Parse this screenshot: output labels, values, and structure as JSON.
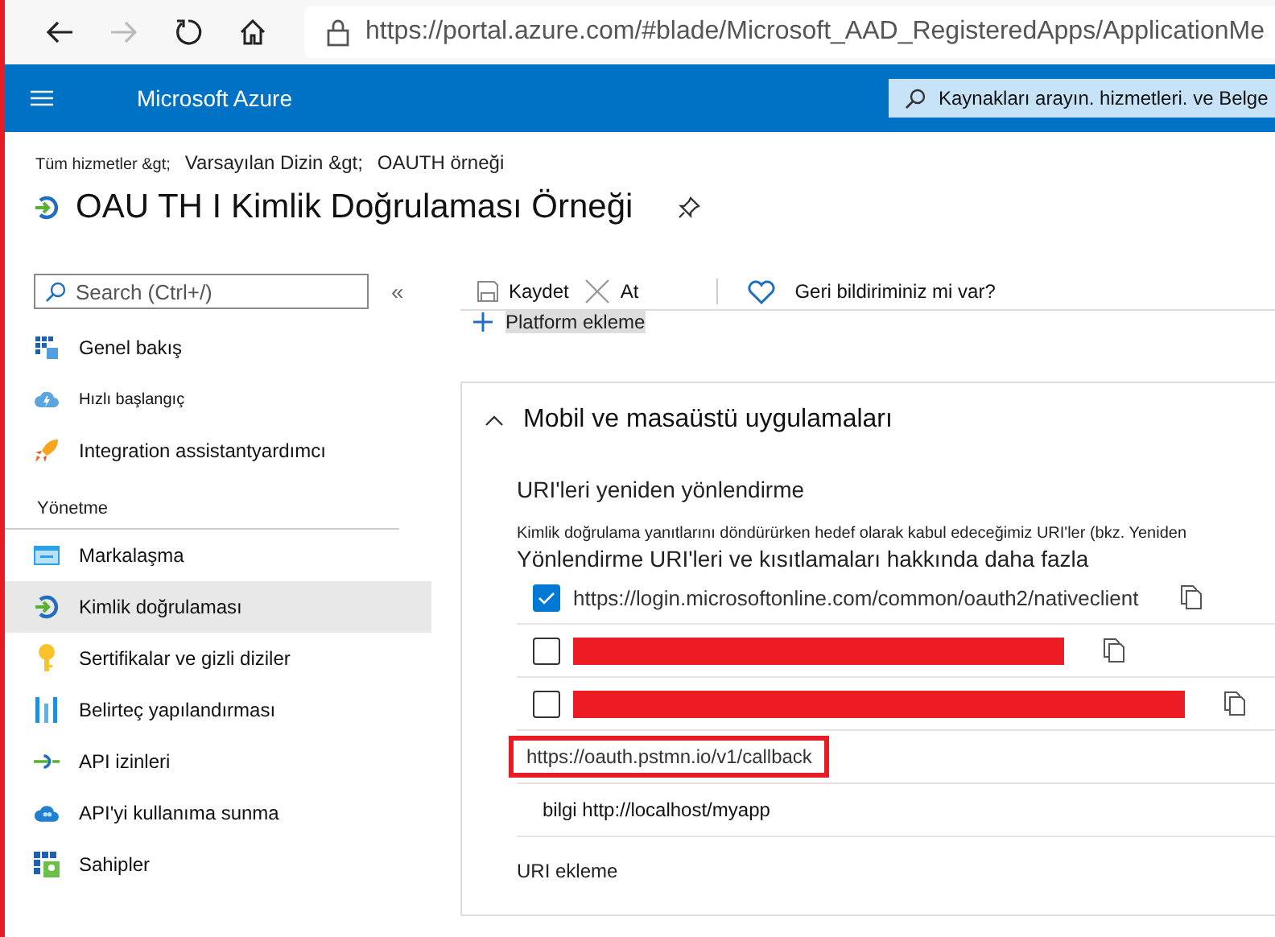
{
  "browser": {
    "url": "https://portal.azure.com/#blade/Microsoft_AAD_RegisteredApps/ApplicationMe"
  },
  "header": {
    "brand": "Microsoft Azure",
    "search_placeholder": "Kaynakları arayın. hizmetleri. ve Belge"
  },
  "breadcrumb": [
    "Tüm hizmetler &gt;",
    "Varsayılan Dizin &gt;",
    "OAUTH örneği"
  ],
  "title": "OAU TH I Kimlik Doğrulaması Örneği",
  "sidebar": {
    "search_placeholder": "Search (Ctrl+/)",
    "collapse": "«",
    "items": [
      {
        "kind": "item",
        "label": "Genel bakış",
        "selected": false
      },
      {
        "kind": "item",
        "label": "Hızlı başlangıç",
        "selected": false
      },
      {
        "kind": "item",
        "label": "Integration assistantyardımcı",
        "selected": false
      },
      {
        "kind": "section",
        "label": "Yönetme"
      },
      {
        "kind": "item",
        "label": "Markalaşma",
        "selected": false
      },
      {
        "kind": "item",
        "label": "Kimlik doğrulaması",
        "selected": true
      },
      {
        "kind": "item",
        "label": "Sertifikalar ve gizli diziler",
        "selected": false
      },
      {
        "kind": "item",
        "label": "Belirteç yapılandırması",
        "selected": false
      },
      {
        "kind": "item",
        "label": "API izinleri",
        "selected": false
      },
      {
        "kind": "item",
        "label": "API'yi kullanıma sunma",
        "selected": false
      },
      {
        "kind": "item",
        "label": "Sahipler",
        "selected": false
      }
    ]
  },
  "toolbar": {
    "save": "Kaydet",
    "discard": "At",
    "feedback": "Geri bildiriminiz mi var?"
  },
  "add_platform": "Platform ekleme",
  "panel": {
    "title": "Mobil ve masaüstü uygulamaları",
    "expanded": true,
    "section_title": "URI'leri yeniden yönlendirme",
    "description": "Kimlik doğrulama yanıtlarını döndürürken hedef olarak kabul edeceğimiz URI'ler (bkz. Yeniden",
    "description_2": "Yönlendirme URI'leri ve kısıtlamaları hakkında daha fazla",
    "uris": [
      {
        "kind": "uri",
        "checked": true,
        "text": "https://login.microsoftonline.com/common/oauth2/nativeclient"
      },
      {
        "kind": "redacted",
        "checked": false
      },
      {
        "kind": "redacted",
        "checked": false
      },
      {
        "kind": "highlighted",
        "value": "https://oauth.pstmn.io/v1/callback"
      },
      {
        "kind": "input",
        "placeholder": "bilgi http://localhost/myapp"
      }
    ],
    "add_uri": "URI ekleme"
  }
}
